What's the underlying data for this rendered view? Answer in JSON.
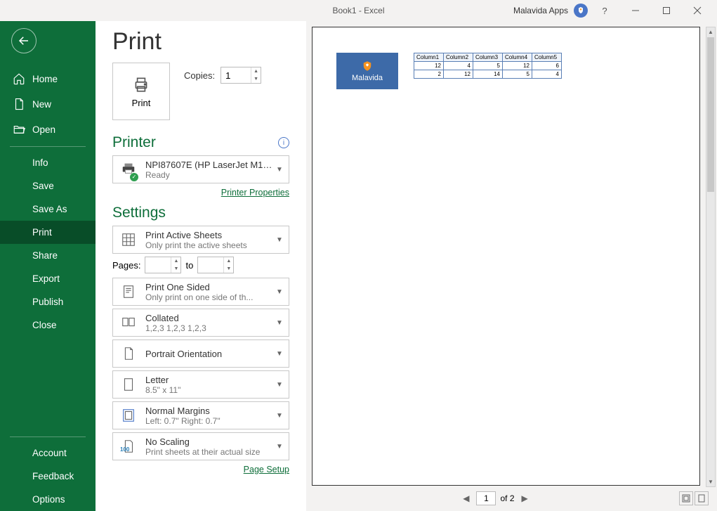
{
  "titlebar": {
    "title": "Book1  -  Excel",
    "appLabel": "Malavida Apps",
    "help": "?"
  },
  "sidebar": {
    "home": "Home",
    "new": "New",
    "open": "Open",
    "info": "Info",
    "save": "Save",
    "saveAs": "Save As",
    "print": "Print",
    "share": "Share",
    "export": "Export",
    "publish": "Publish",
    "close": "Close",
    "account": "Account",
    "feedback": "Feedback",
    "options": "Options"
  },
  "page": {
    "title": "Print"
  },
  "printButton": {
    "label": "Print"
  },
  "copies": {
    "label": "Copies:",
    "value": "1"
  },
  "printer": {
    "header": "Printer",
    "name": "NPI87607E (HP LaserJet M15...",
    "status": "Ready",
    "propertiesLink": "Printer Properties"
  },
  "settings": {
    "header": "Settings",
    "activeSheets": {
      "title": "Print Active Sheets",
      "sub": "Only print the active sheets"
    },
    "pages": {
      "label": "Pages:",
      "from": "",
      "toLabel": "to",
      "to": ""
    },
    "oneSided": {
      "title": "Print One Sided",
      "sub": "Only print on one side of th..."
    },
    "collated": {
      "title": "Collated",
      "sub": "1,2,3    1,2,3    1,2,3"
    },
    "orientation": {
      "title": "Portrait Orientation"
    },
    "paper": {
      "title": "Letter",
      "sub": "8.5\" x 11\""
    },
    "margins": {
      "title": "Normal Margins",
      "sub": "Left:  0.7\"    Right:  0.7\""
    },
    "scaling": {
      "title": "No Scaling",
      "sub": "Print sheets at their actual size",
      "badge": "100"
    },
    "pageSetupLink": "Page Setup"
  },
  "preview": {
    "logoText": "Malavida",
    "columns": [
      "Column1",
      "Column2",
      "Column3",
      "Column4",
      "Column5"
    ],
    "rows": [
      [
        12,
        4,
        5,
        12,
        6
      ],
      [
        2,
        12,
        14,
        5,
        4
      ]
    ],
    "currentPage": "1",
    "pageOf": "of 2"
  }
}
